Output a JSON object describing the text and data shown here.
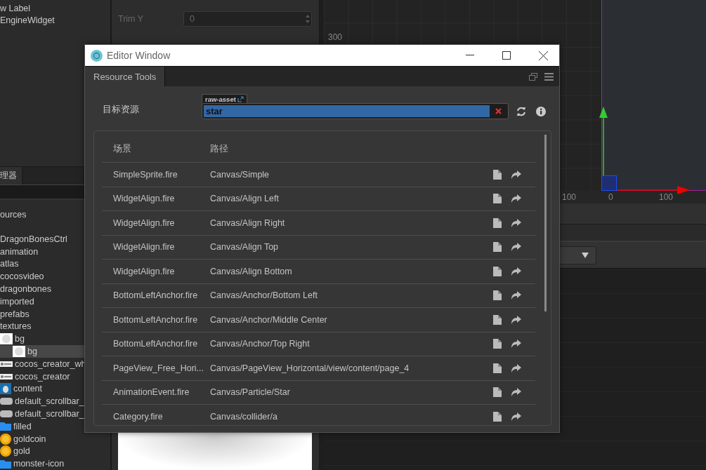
{
  "hierarchy": {
    "items": [
      {
        "label": "w Label"
      },
      {
        "label": "EngineWidget"
      }
    ]
  },
  "inspector": {
    "fields": [
      {
        "label": "Trim Y",
        "value": "0"
      }
    ]
  },
  "assets_panel": {
    "tab": "理器",
    "items": [
      {
        "label": "ources",
        "kind": "none",
        "selected": false
      },
      {
        "label": "DragonBonesCtrl",
        "kind": "none",
        "selected": false
      },
      {
        "label": "animation",
        "kind": "none",
        "selected": false
      },
      {
        "label": "atlas",
        "kind": "none",
        "selected": false
      },
      {
        "label": "cocosvideo",
        "kind": "none",
        "selected": false
      },
      {
        "label": "dragonbones",
        "kind": "none",
        "selected": false
      },
      {
        "label": "imported",
        "kind": "none",
        "selected": false
      },
      {
        "label": "prefabs",
        "kind": "none",
        "selected": false
      },
      {
        "label": "textures",
        "kind": "none",
        "selected": false
      },
      {
        "label": "bg",
        "kind": "texture",
        "selected": false,
        "children": [
          {
            "label": "bg",
            "kind": "texture",
            "selected": true
          }
        ]
      },
      {
        "label": "cocos_creator_wh",
        "kind": "logo",
        "selected": false
      },
      {
        "label": "cocos_creator",
        "kind": "logo",
        "selected": false
      },
      {
        "label": "content",
        "kind": "photo",
        "selected": false
      },
      {
        "label": "default_scrollbar_",
        "kind": "scrollbar",
        "selected": false
      },
      {
        "label": "default_scrollbar_",
        "kind": "scrollbar",
        "selected": false
      },
      {
        "label": "filled",
        "kind": "folder",
        "selected": false
      },
      {
        "label": "goldcoin",
        "kind": "coin",
        "selected": false
      },
      {
        "label": "gold",
        "kind": "coin",
        "selected": false
      },
      {
        "label": "monster-icon",
        "kind": "folder",
        "selected": false
      }
    ]
  },
  "scene": {
    "y_labels": [
      "300"
    ],
    "x_labels": [
      "100",
      "0",
      "100"
    ]
  },
  "dialog": {
    "title": "Editor Window",
    "tabs": [
      {
        "label": "Resource Tools",
        "selected": true
      }
    ],
    "target": {
      "label": "目标资源",
      "asset_type": "raw-asset",
      "value": "star"
    },
    "table": {
      "columns": [
        "场景",
        "路径"
      ],
      "rows": [
        {
          "scene": "SimpleSprite.fire",
          "path": "Canvas/Simple"
        },
        {
          "scene": "WidgetAlign.fire",
          "path": "Canvas/Align Left"
        },
        {
          "scene": "WidgetAlign.fire",
          "path": "Canvas/Align Right"
        },
        {
          "scene": "WidgetAlign.fire",
          "path": "Canvas/Align Top"
        },
        {
          "scene": "WidgetAlign.fire",
          "path": "Canvas/Align Bottom"
        },
        {
          "scene": "BottomLeftAnchor.fire",
          "path": "Canvas/Anchor/Bottom Left"
        },
        {
          "scene": "BottomLeftAnchor.fire",
          "path": "Canvas/Anchor/Middle Center"
        },
        {
          "scene": "BottomLeftAnchor.fire",
          "path": "Canvas/Anchor/Top Right"
        },
        {
          "scene": "PageView_Free_Hori...",
          "path": "Canvas/PageView_Horizontal/view/content/page_4"
        },
        {
          "scene": "AnimationEvent.fire",
          "path": "Canvas/Particle/Star"
        },
        {
          "scene": "Category.fire",
          "path": "Canvas/collider/a"
        }
      ]
    }
  }
}
